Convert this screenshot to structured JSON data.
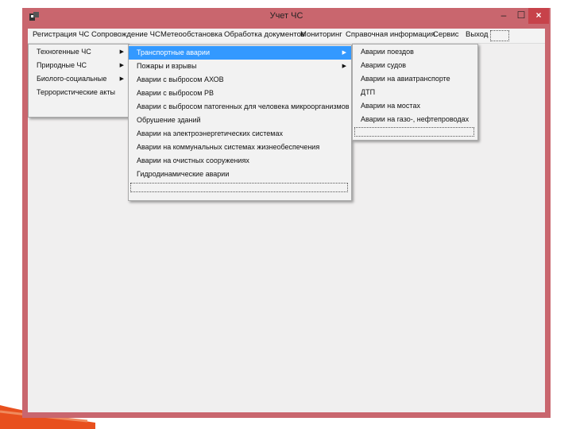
{
  "window": {
    "title": "Учет ЧС",
    "controls": {
      "minimize": "–",
      "maximize": "☐",
      "close": "×"
    }
  },
  "menubar": {
    "items": [
      "Регистрация ЧС",
      "Сопровождение ЧС",
      "Метеообстановка",
      "Обработка документов",
      "Мониторинг",
      "Справочная информация",
      "Сервис",
      "Выход"
    ]
  },
  "menu1": {
    "items": [
      {
        "label": "Техногенные ЧС",
        "submenu": true
      },
      {
        "label": "Природные ЧС",
        "submenu": true
      },
      {
        "label": "Биолого-социальные",
        "submenu": true
      },
      {
        "label": "Террористические акты",
        "submenu": false
      }
    ]
  },
  "menu2": {
    "highlighted": 0,
    "items": [
      {
        "label": "Транспортные аварии",
        "submenu": true
      },
      {
        "label": "Пожары и взрывы",
        "submenu": true
      },
      {
        "label": "Аварии с выбросом АХОВ",
        "submenu": false
      },
      {
        "label": "Аварии с выбросом РВ",
        "submenu": false
      },
      {
        "label": "Аварии с выбросом патогенных для человека микроорганизмов",
        "submenu": false
      },
      {
        "label": "Обрушение зданий",
        "submenu": false
      },
      {
        "label": "Аварии на электроэнергетических системах",
        "submenu": false
      },
      {
        "label": "Аварии на коммунальных системах жизнеобеспечения",
        "submenu": false
      },
      {
        "label": "Аварии на очистных сооружениях",
        "submenu": false
      },
      {
        "label": "Гидродинамические аварии",
        "submenu": false
      }
    ]
  },
  "menu3": {
    "items": [
      {
        "label": "Аварии поездов"
      },
      {
        "label": "Аварии судов"
      },
      {
        "label": "Аварии на авиатранспорте"
      },
      {
        "label": "ДТП"
      },
      {
        "label": "Аварии на мостах"
      },
      {
        "label": "Аварии на газо-, нефтепроводах"
      }
    ]
  },
  "colors": {
    "window_frame": "#c9666e",
    "highlight": "#3399ff",
    "close_button": "#c7424a",
    "accent_swoosh": "#e8501e"
  }
}
